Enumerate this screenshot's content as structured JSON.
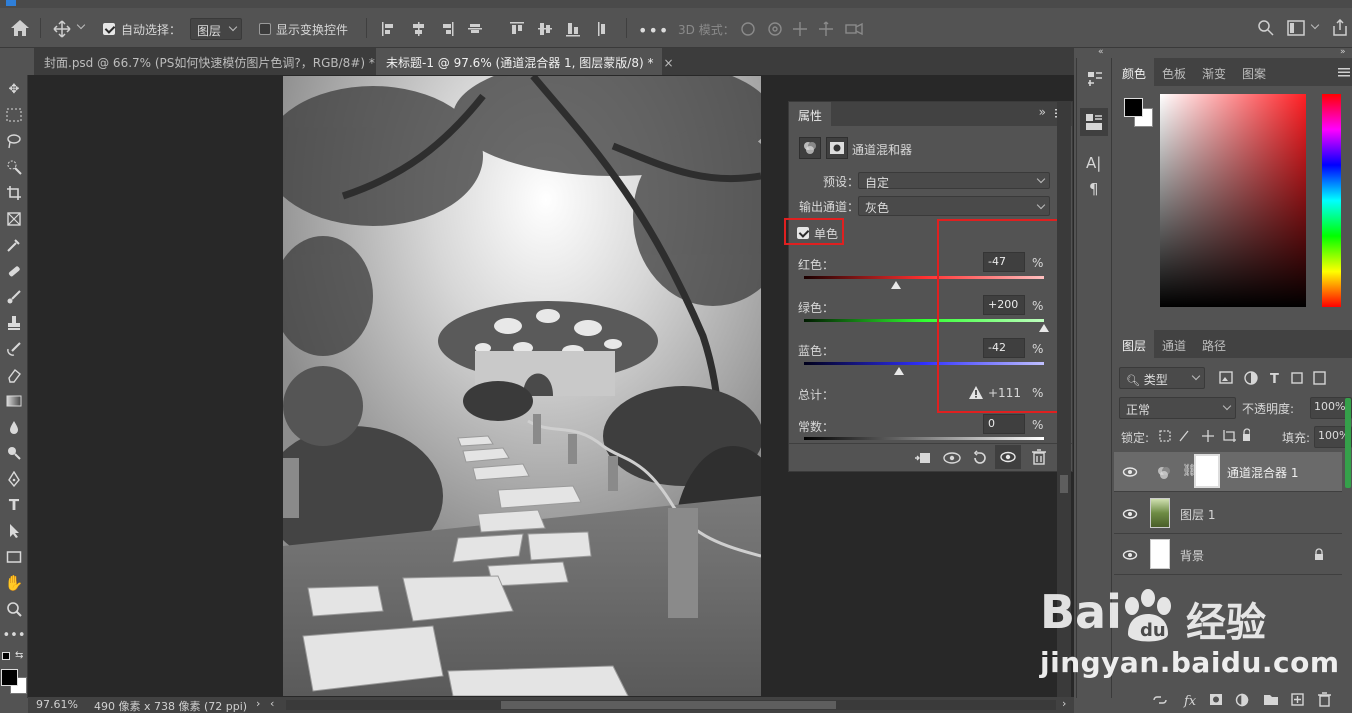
{
  "options_bar": {
    "auto_select_label": "自动选择：",
    "auto_select_value": "图层",
    "show_transform_label": "显示变换控件",
    "mode_3d_label": "3D 模式："
  },
  "tabs": [
    {
      "label": "封面.psd @ 66.7% (PS如何快速模仿图片色调?，RGB/8#) *",
      "active": false
    },
    {
      "label": "未标题-1 @ 97.6% (通道混合器 1, 图层蒙版/8) *",
      "active": true
    }
  ],
  "properties": {
    "panel_title": "属性",
    "adjustment_name": "通道混和器",
    "preset_label": "预设：",
    "preset_value": "自定",
    "output_label": "输出通道：",
    "output_value": "灰色",
    "monochrome_label": "单色",
    "monochrome_checked": true,
    "red": {
      "label": "红色：",
      "value": "-47",
      "pos": 0.383
    },
    "green": {
      "label": "绿色：",
      "value": "+200",
      "pos": 1.0
    },
    "blue": {
      "label": "蓝色：",
      "value": "-42",
      "pos": 0.395
    },
    "total": {
      "label": "总计：",
      "value": "+111"
    },
    "constant": {
      "label": "常数：",
      "value": "0"
    },
    "percent": "%"
  },
  "color_panel": {
    "tabs": [
      "颜色",
      "色板",
      "渐变",
      "图案"
    ],
    "active": "颜色",
    "foreground": "#000000",
    "background": "#ffffff"
  },
  "layers_panel": {
    "tabs": [
      "图层",
      "通道",
      "路径"
    ],
    "active": "图层",
    "filter_label": "类型",
    "blend_mode": "正常",
    "opacity_label": "不透明度:",
    "opacity_value": "100%",
    "lock_label": "锁定:",
    "fill_label": "填充:",
    "fill_value": "100%",
    "layers": [
      {
        "name": "通道混合器 1",
        "kind": "adjustment",
        "active": true
      },
      {
        "name": "图层 1",
        "kind": "image",
        "active": false
      },
      {
        "name": "背景",
        "kind": "background",
        "active": false,
        "locked": true
      }
    ]
  },
  "status_bar": {
    "zoom": "97.61%",
    "doc_info": "490 像素 x 738 像素 (72 ppi)"
  },
  "watermark": {
    "brand": "Bai",
    "brand2": "经验",
    "url": "jingyan.baidu.com"
  },
  "colors": {
    "highlight_red": "#e02020",
    "panel_bg": "#535353",
    "canvas_bg": "#282828"
  }
}
